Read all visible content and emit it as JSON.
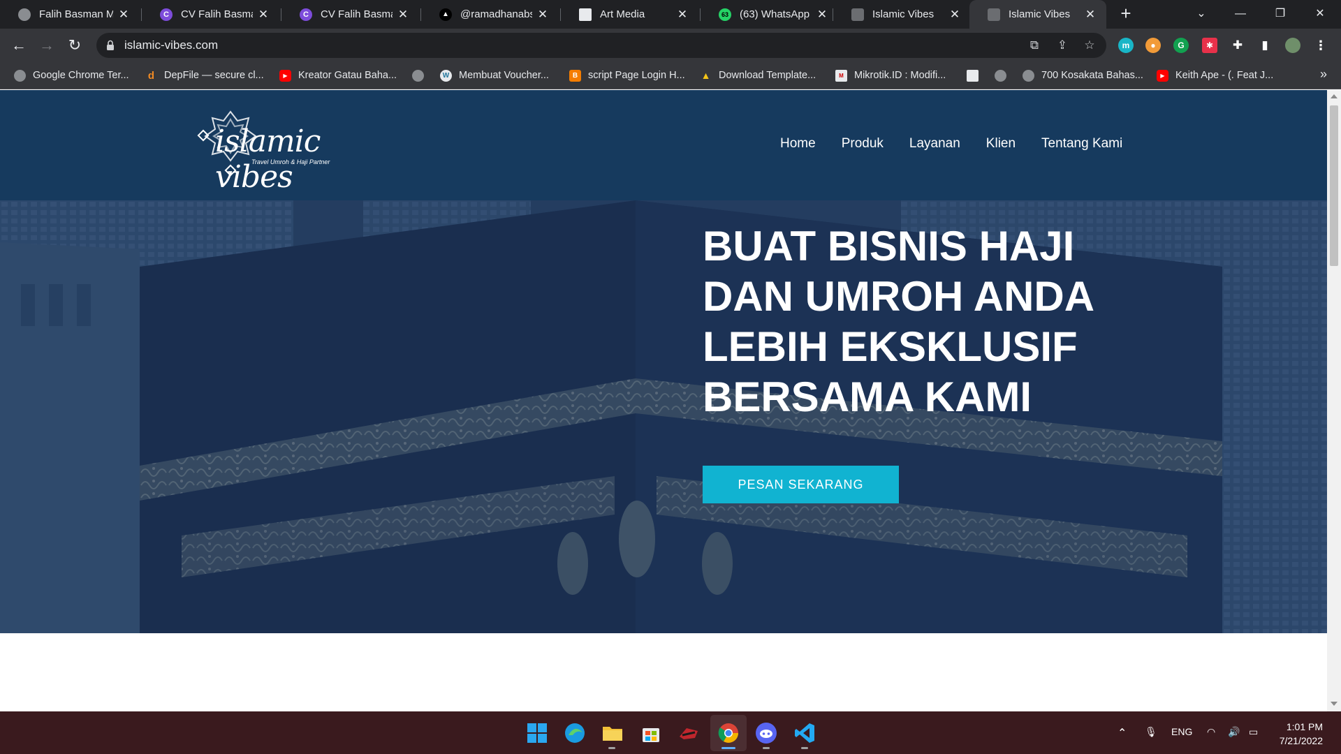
{
  "browser": {
    "tabs": [
      {
        "title": "Falih Basman Mul",
        "icon": "globe-icon",
        "active": false
      },
      {
        "title": "CV Falih Basman I",
        "icon": "canva-icon",
        "active": false
      },
      {
        "title": "CV Falih Basman I",
        "icon": "canva-icon",
        "active": false
      },
      {
        "title": "@ramadhanabs",
        "icon": "vercel-icon",
        "active": false
      },
      {
        "title": "Art Media",
        "icon": "page-icon",
        "active": false
      },
      {
        "title": "(63) WhatsApp",
        "icon": "whatsapp-icon",
        "active": false
      },
      {
        "title": "Islamic Vibes",
        "icon": "site-logo-icon",
        "active": false
      },
      {
        "title": "Islamic Vibes",
        "icon": "site-logo-icon",
        "active": true
      }
    ],
    "whatsapp_badge": "63",
    "url": "islamic-vibes.com",
    "bookmarks": [
      {
        "label": "Google Chrome Ter...",
        "icon": "globe-icon"
      },
      {
        "label": "DepFile — secure cl...",
        "icon": "depfile-icon"
      },
      {
        "label": "Kreator Gatau Baha...",
        "icon": "youtube-icon"
      },
      {
        "label": "",
        "icon": "globe-icon"
      },
      {
        "label": "Membuat Voucher...",
        "icon": "wordpress-icon"
      },
      {
        "label": "script Page Login H...",
        "icon": "blogger-icon"
      },
      {
        "label": "Download Template...",
        "icon": "linux-icon"
      },
      {
        "label": "Mikrotik.ID : Modifi...",
        "icon": "mikrotik-icon"
      },
      {
        "label": "",
        "icon": "page-icon"
      },
      {
        "label": "",
        "icon": "globe-icon"
      },
      {
        "label": "700 Kosakata Bahas...",
        "icon": "globe-icon"
      },
      {
        "label": "Keith Ape - (. Feat J...",
        "icon": "youtube-icon"
      }
    ]
  },
  "site": {
    "logo_text": "islamic vibes",
    "logo_tagline": "Travel Umroh & Haji Partner",
    "nav": [
      "Home",
      "Produk",
      "Layanan",
      "Klien",
      "Tentang Kami"
    ],
    "hero_title_lines": [
      "BUAT BISNIS HAJI",
      "DAN UMROH ANDA",
      "LEBIH EKSKLUSIF",
      "BERSAMA KAMI"
    ],
    "cta_label": "PESAN SEKARANG"
  },
  "taskbar": {
    "apps": [
      "windows-start-icon",
      "edge-icon",
      "file-explorer-icon",
      "store-icon",
      "game-icon",
      "chrome-icon",
      "discord-icon",
      "vscode-icon"
    ],
    "language": "ENG",
    "time": "1:01 PM",
    "date": "7/21/2022"
  },
  "colors": {
    "header_bg": "#163a5e",
    "hero_overlay": "#1d3557",
    "cta_bg": "#11b3d1",
    "taskbar_bg": "#3a1a1e"
  }
}
